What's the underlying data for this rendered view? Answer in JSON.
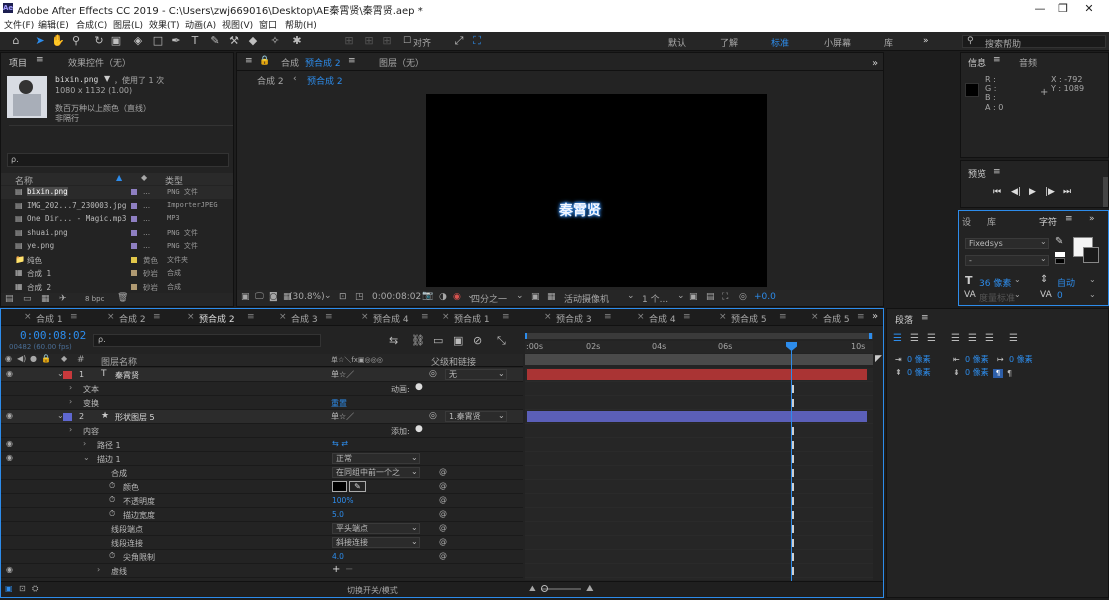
{
  "title": {
    "text": "Adobe After Effects CC 2019 - C:\\Users\\zwj669016\\Desktop\\AE秦霄贤\\秦霄贤.aep *",
    "logo": "Ae"
  },
  "window_controls": {
    "min": "—",
    "max": "❐",
    "close": "✕"
  },
  "menu": [
    "文件(F)",
    "编辑(E)",
    "合成(C)",
    "图层(L)",
    "效果(T)",
    "动画(A)",
    "视图(V)",
    "窗口",
    "帮助(H)"
  ],
  "toolbar": {
    "align_label": "对齐",
    "workspaces": [
      "默认",
      "了解",
      "标准",
      "小屏幕",
      "库"
    ],
    "active_workspace": "标准",
    "more": "»",
    "search_placeholder": "搜索帮助"
  },
  "project": {
    "tab": "项目",
    "effects_tab": "效果控件（无）",
    "file": "bixin.png",
    "used": "，使用了 1 次",
    "dims": "1080 x 1132 (1.00)",
    "color": "数百万种以上颜色（直线）",
    "interlace": "非隔行",
    "search_placeholder": "ρ.",
    "col_name": "名称",
    "col_type": "类型",
    "items": [
      {
        "name": "bixin.png",
        "label": "",
        "type": "PNG 文件",
        "color": "#8e7fc2",
        "selected": true
      },
      {
        "name": "IMG_202...7_230003.jpg",
        "label": "",
        "type": "ImporterJPEG",
        "color": "#8e7fc2"
      },
      {
        "name": "One Dir... - Magic.mp3",
        "label": "",
        "type": "MP3",
        "color": "#8e7fc2"
      },
      {
        "name": "shuai.png",
        "label": "",
        "type": "PNG 文件",
        "color": "#8e7fc2"
      },
      {
        "name": "ye.png",
        "label": "",
        "type": "PNG 文件",
        "color": "#8e7fc2"
      },
      {
        "name": "纯色",
        "label": "黄色",
        "type": "文件夹",
        "color": "#e2c84a"
      },
      {
        "name": "合成 1",
        "label": "砂岩",
        "type": "合成",
        "color": "#b09a72"
      },
      {
        "name": "合成 2",
        "label": "砂岩",
        "type": "合成",
        "color": "#b09a72"
      }
    ],
    "footer_bpc": "8 bpc"
  },
  "viewer": {
    "tab_prefix": "合成",
    "tab_name": "预合成 2",
    "layer_tab": "图层（无）",
    "crumbs": [
      "合成 2",
      "预合成 2"
    ],
    "canvas_text": "秦霄贤",
    "zoom": "(30.8%)",
    "time": "0:00:08:02",
    "res": "四分之一",
    "camera": "活动摄像机",
    "views": "1 个...",
    "exposure": "+0.0"
  },
  "info": {
    "tab": "信息",
    "audio_tab": "音频",
    "r": "R :",
    "g": "G :",
    "b": "B :",
    "a": "A : 0",
    "x": "X : -792",
    "y": "Y : 1089"
  },
  "preview": {
    "tab": "预览"
  },
  "char_panel": {
    "tabs": [
      "设",
      "库",
      "字符"
    ],
    "font": "Fixedsys",
    "style": "-",
    "size": "36 像素",
    "leading": "自动",
    "tracking": "度量标准",
    "tsume": "0"
  },
  "para": {
    "tab": "段落",
    "vals": [
      "0 像素",
      "0 像素",
      "0 像素",
      "0 像素",
      "0 像素"
    ]
  },
  "timeline": {
    "tabs": [
      "合成 1",
      "合成 2",
      "预合成 2",
      "合成 3",
      "预合成 4",
      "预合成 1",
      "预合成 3",
      "合成 4",
      "预合成 5",
      "合成 5"
    ],
    "active": "预合成 2",
    "time": "0:00:08:02",
    "fps": "00482 (60.00 fps)",
    "search_placeholder": "ρ.",
    "hdr": {
      "num": "#",
      "name": "图层名称",
      "switches": "单☆＼fx▣◎◎◎",
      "parent": "父级和链接"
    },
    "ruler": [
      ":00s",
      "02s",
      "04s",
      "06s",
      "",
      "10s"
    ],
    "rows": [
      {
        "num": "1",
        "name": "秦霄贤",
        "type": "T",
        "parent": "无",
        "color": "#c8393c",
        "bar": "#aa3434",
        "level": 0
      },
      {
        "name": "文本",
        "level": 1,
        "extra": "动画:"
      },
      {
        "name": "变换",
        "level": 1,
        "extra": "重置"
      },
      {
        "num": "2",
        "name": "形状图层 5",
        "type": "★",
        "parent": "1.秦霄贤",
        "color": "#5f68d1",
        "bar": "#5b5fb8",
        "level": 0
      },
      {
        "name": "内容",
        "level": 1,
        "extra": "添加:"
      },
      {
        "name": "路径 1",
        "level": 2
      },
      {
        "name": "描边 1",
        "level": 2,
        "val": "正常"
      },
      {
        "name": "合成",
        "level": 3,
        "val": "在同组中前一个之"
      },
      {
        "name": "颜色",
        "level": 3
      },
      {
        "name": "不透明度",
        "level": 3,
        "val": "100%"
      },
      {
        "name": "描边宽度",
        "level": 3,
        "val": "5.0"
      },
      {
        "name": "线段端点",
        "level": 3,
        "val": "平头端点"
      },
      {
        "name": "线段连接",
        "level": 3,
        "val": "斜接连接"
      },
      {
        "name": "尖角限制",
        "level": 3,
        "val": "4.0"
      },
      {
        "name": "虚线",
        "level": 3
      }
    ],
    "footer": "切换开关/模式"
  }
}
